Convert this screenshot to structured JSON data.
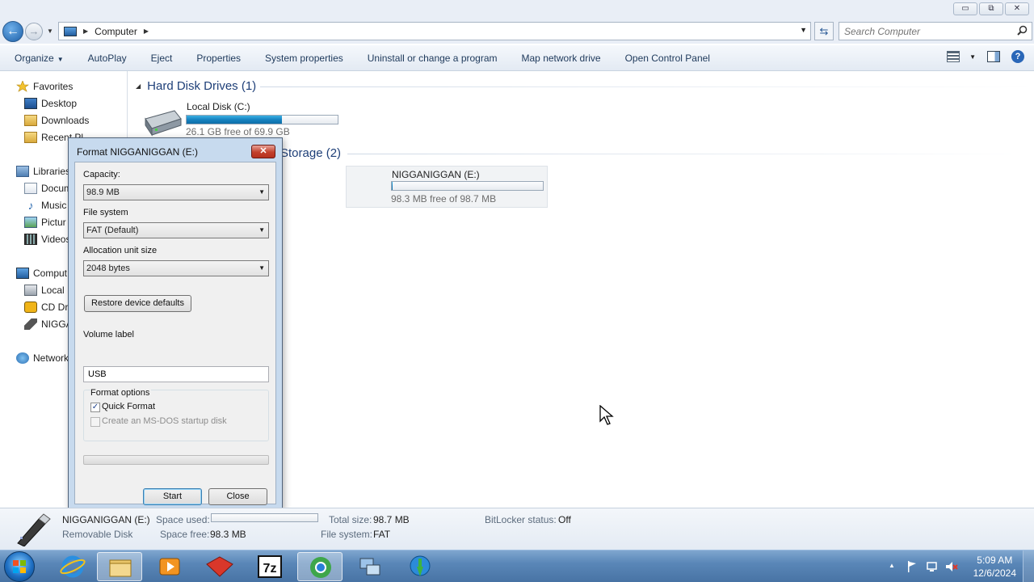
{
  "window": {
    "minimize_glyph": "▭",
    "maximize_glyph": "⧉",
    "close_glyph": "✕"
  },
  "address": {
    "path_label": "Computer",
    "search_placeholder": "Search Computer"
  },
  "commands": {
    "organize": "Organize",
    "autoplay": "AutoPlay",
    "eject": "Eject",
    "properties": "Properties",
    "system_properties": "System properties",
    "uninstall": "Uninstall or change a program",
    "map_drive": "Map network drive",
    "control_panel": "Open Control Panel"
  },
  "nav": {
    "favorites": "Favorites",
    "desktop": "Desktop",
    "downloads": "Downloads",
    "recent": "Recent Pl",
    "libraries": "Libraries",
    "documents": "Docum",
    "music": "Music",
    "pictures": "Pictur",
    "videos": "Videos",
    "computer": "Comput",
    "local_disk": "Local",
    "cd_drive": "CD Dr",
    "usb": "NIGGA",
    "network": "Network"
  },
  "content": {
    "hdd_group": "Hard Disk Drives (1)",
    "removable_group": "Storage (2)",
    "drive_c_name": "Local Disk (C:)",
    "drive_c_free": "26.1 GB free of 69.9 GB",
    "drive_c_used_fraction": 0.63,
    "drive_e_name": "NIGGANIGGAN (E:)",
    "drive_e_free": "98.3 MB free of 98.7 MB",
    "drive_e_used_fraction": 0.004
  },
  "dialog": {
    "title": "Format NIGGANIGGAN (E:)",
    "close_glyph": "✕",
    "capacity_label": "Capacity:",
    "capacity_value": "98.9 MB",
    "fs_label": "File system",
    "fs_value": "FAT (Default)",
    "alloc_label": "Allocation unit size",
    "alloc_value": "2048 bytes",
    "restore_button": "Restore device defaults",
    "volume_label": "Volume label",
    "volume_value": "USB",
    "format_options": "Format options",
    "quick_format": "Quick Format",
    "quick_format_checked": true,
    "msdos": "Create an MS-DOS startup disk",
    "msdos_checked": false,
    "check_glyph": "✓",
    "start_button": "Start",
    "close_button": "Close"
  },
  "details": {
    "name": "NIGGANIGGAN (E:)",
    "type": "Removable Disk",
    "space_used_label": "Space used:",
    "space_free_label": "Space free:",
    "space_free_value": "98.3 MB",
    "total_size_label": "Total size:",
    "total_size_value": "98.7 MB",
    "fs_label": "File system:",
    "fs_value": "FAT",
    "bitlocker_label": "BitLocker status:",
    "bitlocker_value": "Off"
  },
  "taskbar": {
    "time": "5:09 AM",
    "date": "12/6/2024",
    "tray_up_glyph": "▲"
  },
  "colors": {
    "accent": "#1e3f78",
    "capacity_fill": "#1682c1"
  }
}
